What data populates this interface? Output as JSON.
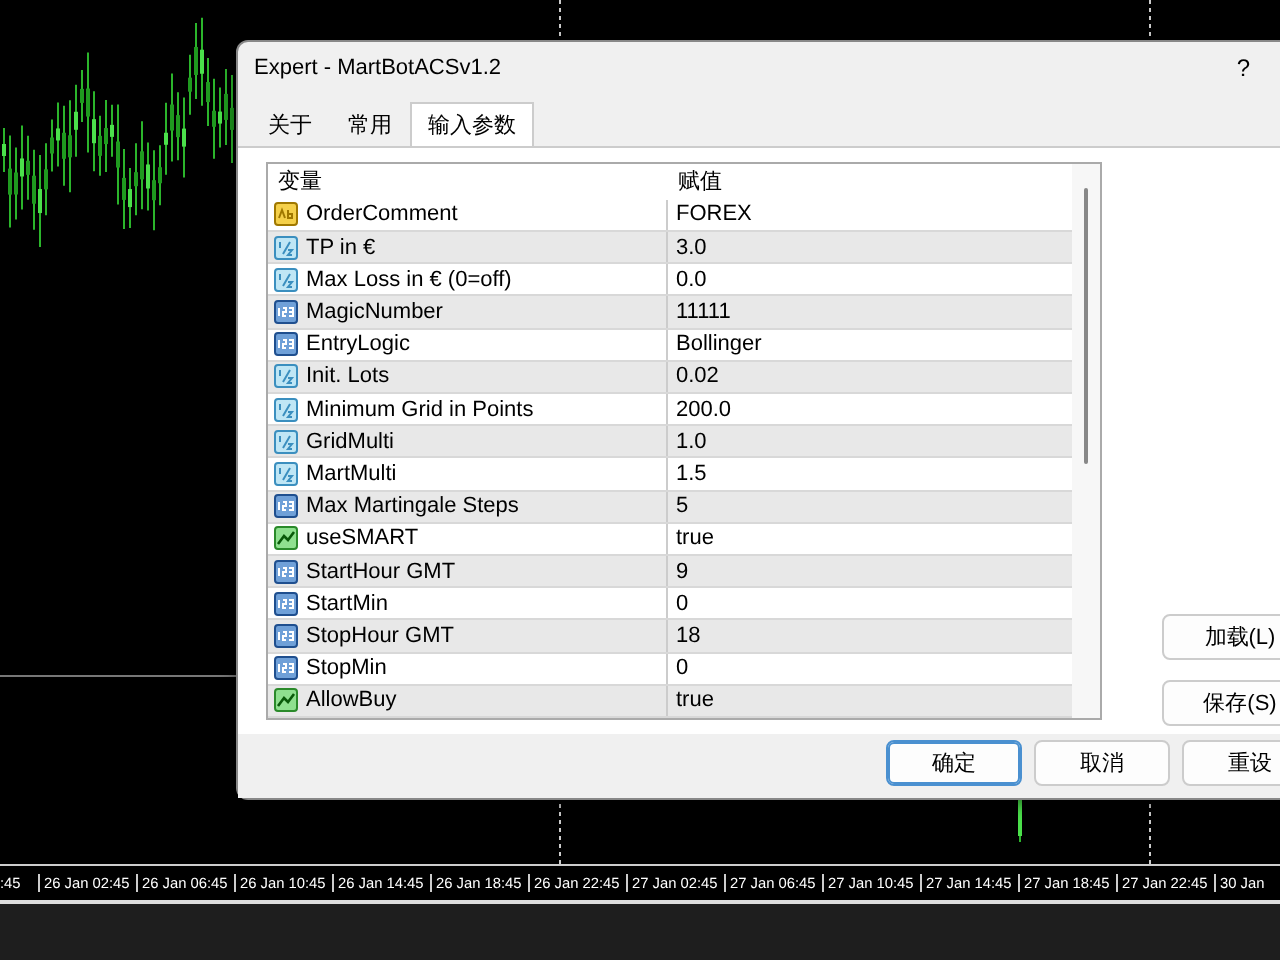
{
  "time_axis": {
    "labels": [
      ":45",
      "26 Jan 02:45",
      "26 Jan 06:45",
      "26 Jan 10:45",
      "26 Jan 14:45",
      "26 Jan 18:45",
      "26 Jan 22:45",
      "27 Jan 02:45",
      "27 Jan 06:45",
      "27 Jan 10:45",
      "27 Jan 14:45",
      "27 Jan 18:45",
      "27 Jan 22:45",
      "30 Jan"
    ]
  },
  "dialog": {
    "title": "Expert - MartBotACSv1.2",
    "help": "?",
    "tabs": [
      {
        "label": "关于",
        "selected": false
      },
      {
        "label": "常用",
        "selected": false
      },
      {
        "label": "输入参数",
        "selected": true
      }
    ],
    "table": {
      "columns": [
        "变量",
        "赋值"
      ],
      "rows": [
        {
          "kind": "string",
          "name": "OrderComment",
          "value": "FOREX"
        },
        {
          "kind": "double",
          "name": "TP in €",
          "value": "3.0"
        },
        {
          "kind": "double",
          "name": "Max Loss in € (0=off)",
          "value": "0.0"
        },
        {
          "kind": "int",
          "name": "MagicNumber",
          "value": "11111"
        },
        {
          "kind": "int",
          "name": "EntryLogic",
          "value": "Bollinger"
        },
        {
          "kind": "double",
          "name": "Init. Lots",
          "value": "0.02"
        },
        {
          "kind": "double",
          "name": "Minimum Grid in Points",
          "value": "200.0"
        },
        {
          "kind": "double",
          "name": "GridMulti",
          "value": "1.0"
        },
        {
          "kind": "double",
          "name": "MartMulti",
          "value": "1.5"
        },
        {
          "kind": "int",
          "name": "Max Martingale Steps",
          "value": "5"
        },
        {
          "kind": "bool",
          "name": "useSMART",
          "value": "true"
        },
        {
          "kind": "int",
          "name": "StartHour GMT",
          "value": "9"
        },
        {
          "kind": "int",
          "name": "StartMin",
          "value": "0"
        },
        {
          "kind": "int",
          "name": "StopHour GMT",
          "value": "18"
        },
        {
          "kind": "int",
          "name": "StopMin",
          "value": "0"
        },
        {
          "kind": "bool",
          "name": "AllowBuy",
          "value": "true"
        }
      ]
    },
    "side_buttons": [
      "加载(L)",
      "保存(S)"
    ],
    "buttons": [
      {
        "label": "确定",
        "default": true
      },
      {
        "label": "取消",
        "default": false
      },
      {
        "label": "重设",
        "default": false
      }
    ]
  }
}
